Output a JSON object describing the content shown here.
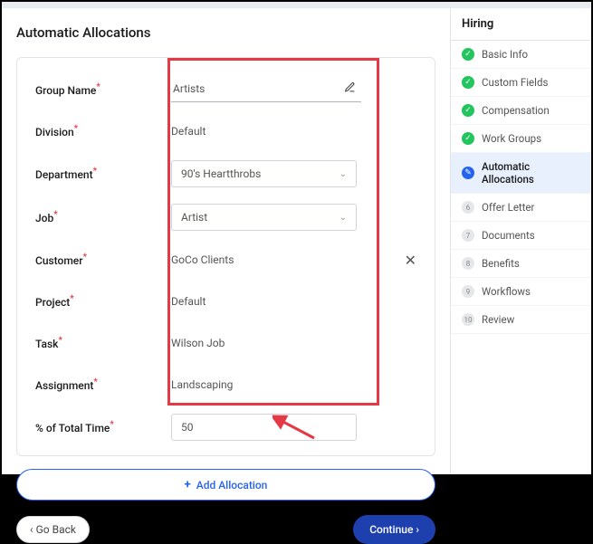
{
  "page": {
    "title": "Automatic Allocations"
  },
  "form": {
    "group_name": {
      "label": "Group Name",
      "value": "Artists"
    },
    "division": {
      "label": "Division",
      "value": "Default"
    },
    "department": {
      "label": "Department",
      "value": "90's Heartthrobs"
    },
    "job": {
      "label": "Job",
      "value": "Artist"
    },
    "customer": {
      "label": "Customer",
      "value": "GoCo Clients"
    },
    "project": {
      "label": "Project",
      "value": "Default"
    },
    "task": {
      "label": "Task",
      "value": "Wilson Job"
    },
    "assignment": {
      "label": "Assignment",
      "value": "Landscaping"
    },
    "percent": {
      "label": "% of Total Time",
      "value": "50"
    }
  },
  "buttons": {
    "add_allocation": "Add Allocation",
    "go_back": "Go Back",
    "continue": "Continue"
  },
  "sidebar": {
    "header": "Hiring",
    "steps": [
      {
        "label": "Basic Info",
        "status": "done"
      },
      {
        "label": "Custom Fields",
        "status": "done"
      },
      {
        "label": "Compensation",
        "status": "done"
      },
      {
        "label": "Work Groups",
        "status": "done"
      },
      {
        "label": "Automatic Allocations",
        "status": "current"
      },
      {
        "label": "Offer Letter",
        "status": "pending",
        "num": "6"
      },
      {
        "label": "Documents",
        "status": "pending",
        "num": "7"
      },
      {
        "label": "Benefits",
        "status": "pending",
        "num": "8"
      },
      {
        "label": "Workflows",
        "status": "pending",
        "num": "9"
      },
      {
        "label": "Review",
        "status": "pending",
        "num": "10"
      }
    ]
  }
}
